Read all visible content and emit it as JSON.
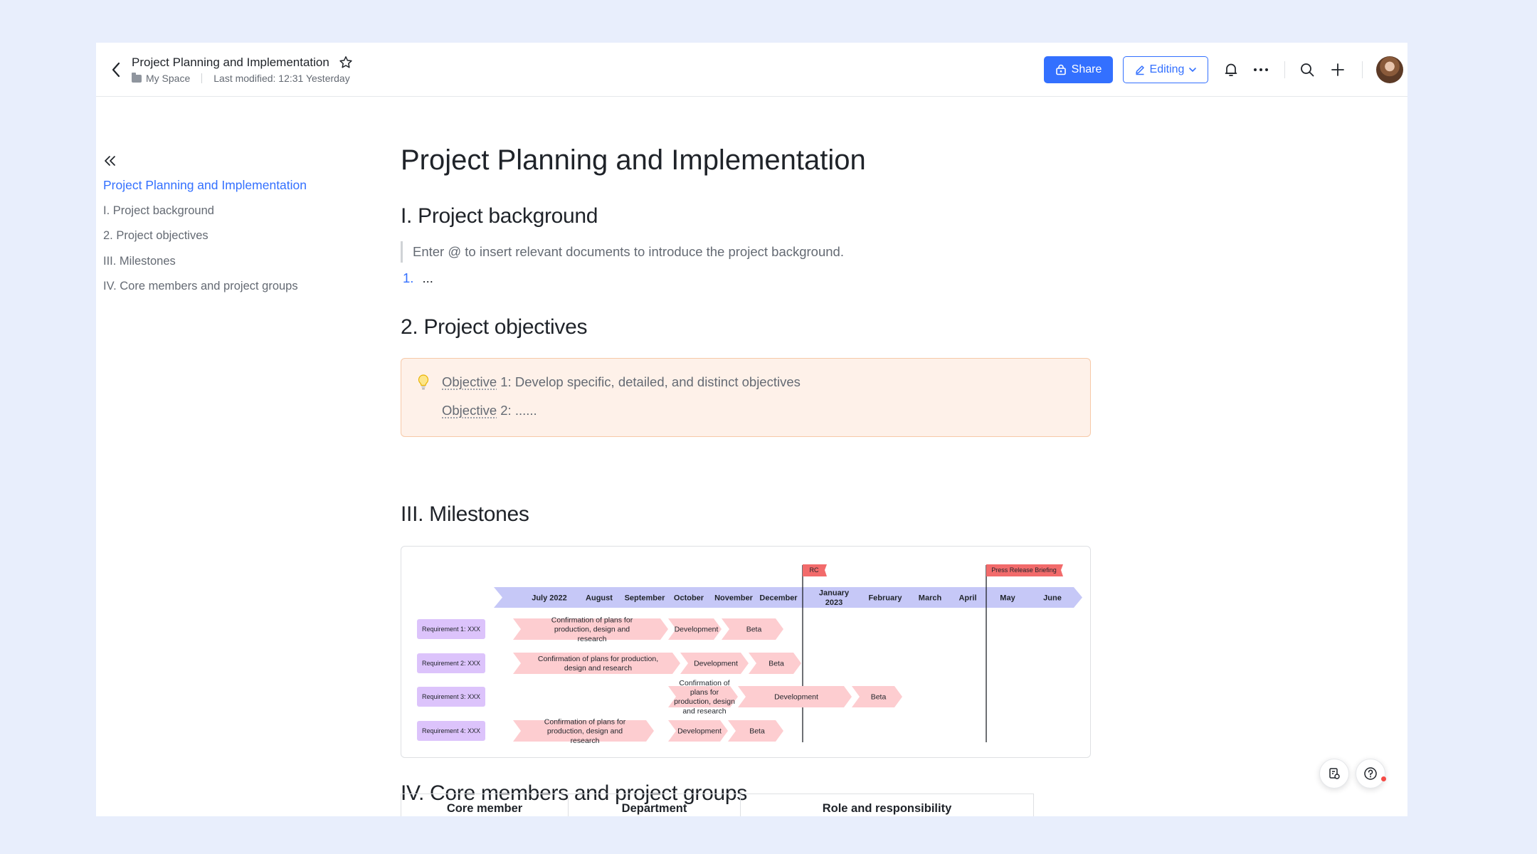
{
  "header": {
    "doc_title": "Project Planning and Implementation",
    "location": "My Space",
    "last_modified": "Last modified: 12:31 Yesterday",
    "share_label": "Share",
    "editing_label": "Editing",
    "accent_color": "#3370ff"
  },
  "toc": {
    "items": [
      {
        "label": "Project Planning and Implementation",
        "active": true
      },
      {
        "label": "I. Project background"
      },
      {
        "label": "2. Project objectives"
      },
      {
        "label": "III. Milestones"
      },
      {
        "label": "IV. Core members and project groups"
      }
    ]
  },
  "doc": {
    "title": "Project Planning and Implementation",
    "sections": {
      "background": {
        "heading": "I. Project background",
        "quote": "Enter @ to insert relevant documents to introduce the project background.",
        "list_num": "1.",
        "list_text": "..."
      },
      "objectives": {
        "heading": "2. Project objectives",
        "obj1_word": "Objective",
        "obj1_rest": " 1: Develop specific, detailed, and distinct objectives",
        "obj2_word": "Objective",
        "obj2_rest": " 2: ......"
      },
      "milestones": {
        "heading": "III. Milestones"
      },
      "members": {
        "heading": "IV. Core members and project groups",
        "columns": [
          "Core member",
          "Department",
          "Role and responsibility"
        ]
      }
    }
  },
  "gantt": {
    "months": [
      "July 2022",
      "August",
      "September",
      "October",
      "November",
      "December",
      "January 2023",
      "February",
      "March",
      "April",
      "May",
      "June"
    ],
    "flags": [
      {
        "label": "RC"
      },
      {
        "label": "Press Release Briefing"
      }
    ],
    "rows": [
      {
        "label": "Requirement 1: XXX",
        "tasks": [
          {
            "text": "Confirmation of plans for production, design and research"
          },
          {
            "text": "Development"
          },
          {
            "text": "Beta"
          }
        ]
      },
      {
        "label": "Requirement 2: XXX",
        "tasks": [
          {
            "text": "Confirmation of plans for production, design and research"
          },
          {
            "text": "Development"
          },
          {
            "text": "Beta"
          }
        ]
      },
      {
        "label": "Requirement 3: XXX",
        "tasks": [
          {
            "text": "Confirmation of plans for production, design and research"
          },
          {
            "text": "Development"
          },
          {
            "text": "Beta"
          }
        ]
      },
      {
        "label": "Requirement 4: XXX",
        "tasks": [
          {
            "text": "Confirmation of plans for production, design and research"
          },
          {
            "text": "Development"
          },
          {
            "text": "Beta"
          }
        ]
      }
    ],
    "colors": {
      "header": "#c6c8f7",
      "task": "#fdcdd0",
      "label": "#dcc3fb",
      "flag": "#f26b6b"
    }
  },
  "icons": [
    "back-icon",
    "star-icon",
    "folder-icon",
    "share-lock-icon",
    "pencil-icon",
    "chevron-down-icon",
    "bell-icon",
    "more-icon",
    "search-icon",
    "plus-icon",
    "collapse-icon",
    "bulb-icon",
    "comment-doc-icon",
    "help-icon"
  ]
}
